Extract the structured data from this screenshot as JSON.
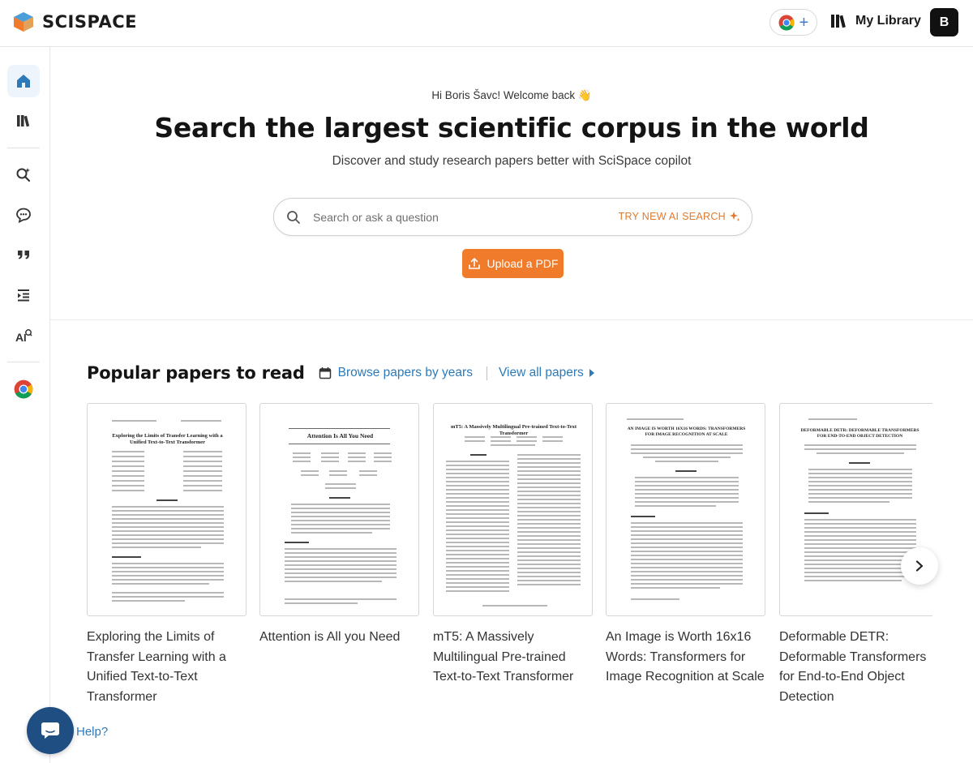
{
  "app": {
    "brand": "SCISPACE"
  },
  "topbar": {
    "my_library_label": "My Library",
    "avatar_initial": "B"
  },
  "hero": {
    "greeting": "Hi Boris Šavc! Welcome back 👋",
    "headline": "Search the largest scientific corpus in the world",
    "subheadline": "Discover and study research papers better with SciSpace copilot",
    "search_placeholder": "Search or ask a question",
    "ai_search_label": "TRY NEW AI SEARCH",
    "upload_label": "Upload a PDF"
  },
  "popular": {
    "title": "Popular papers to read",
    "browse_label": "Browse papers by years",
    "view_all_label": "View all papers",
    "papers": [
      {
        "title": "Exploring the Limits of Transfer Learning with a Unified Text-to-Text Transformer",
        "thumb_heading": "Exploring the Limits of Transfer Learning with a Unified Text-to-Text Transformer"
      },
      {
        "title": "Attention is All you Need",
        "thumb_heading": "Attention Is All You Need"
      },
      {
        "title": "mT5: A Massively Multilingual Pre-trained Text-to-Text Transformer",
        "thumb_heading": "mT5: A Massively Multilingual Pre-trained Text-to-Text Transformer"
      },
      {
        "title": "An Image is Worth 16x16 Words: Transformers for Image Recognition at Scale",
        "thumb_heading": "AN IMAGE IS WORTH 16X16 WORDS: TRANSFORMERS FOR IMAGE RECOGNITION AT SCALE"
      },
      {
        "title": "Deformable DETR: Deformable Transformers for End-to-End Object Detection",
        "thumb_heading": "DEFORMABLE DETR: DEFORMABLE TRANSFORMERS FOR END-TO-END OBJECT DETECTION"
      }
    ]
  },
  "help": {
    "label": "Help?"
  },
  "colors": {
    "accent_orange": "#f07b2b",
    "link_blue": "#2e7ab8",
    "help_navy": "#1f4f82"
  },
  "icons": {
    "sidebar": [
      "home-icon",
      "library-icon",
      "ai-search-icon",
      "chat-icon",
      "quote-icon",
      "outline-icon",
      "ai-writer-icon",
      "chrome-icon"
    ]
  }
}
